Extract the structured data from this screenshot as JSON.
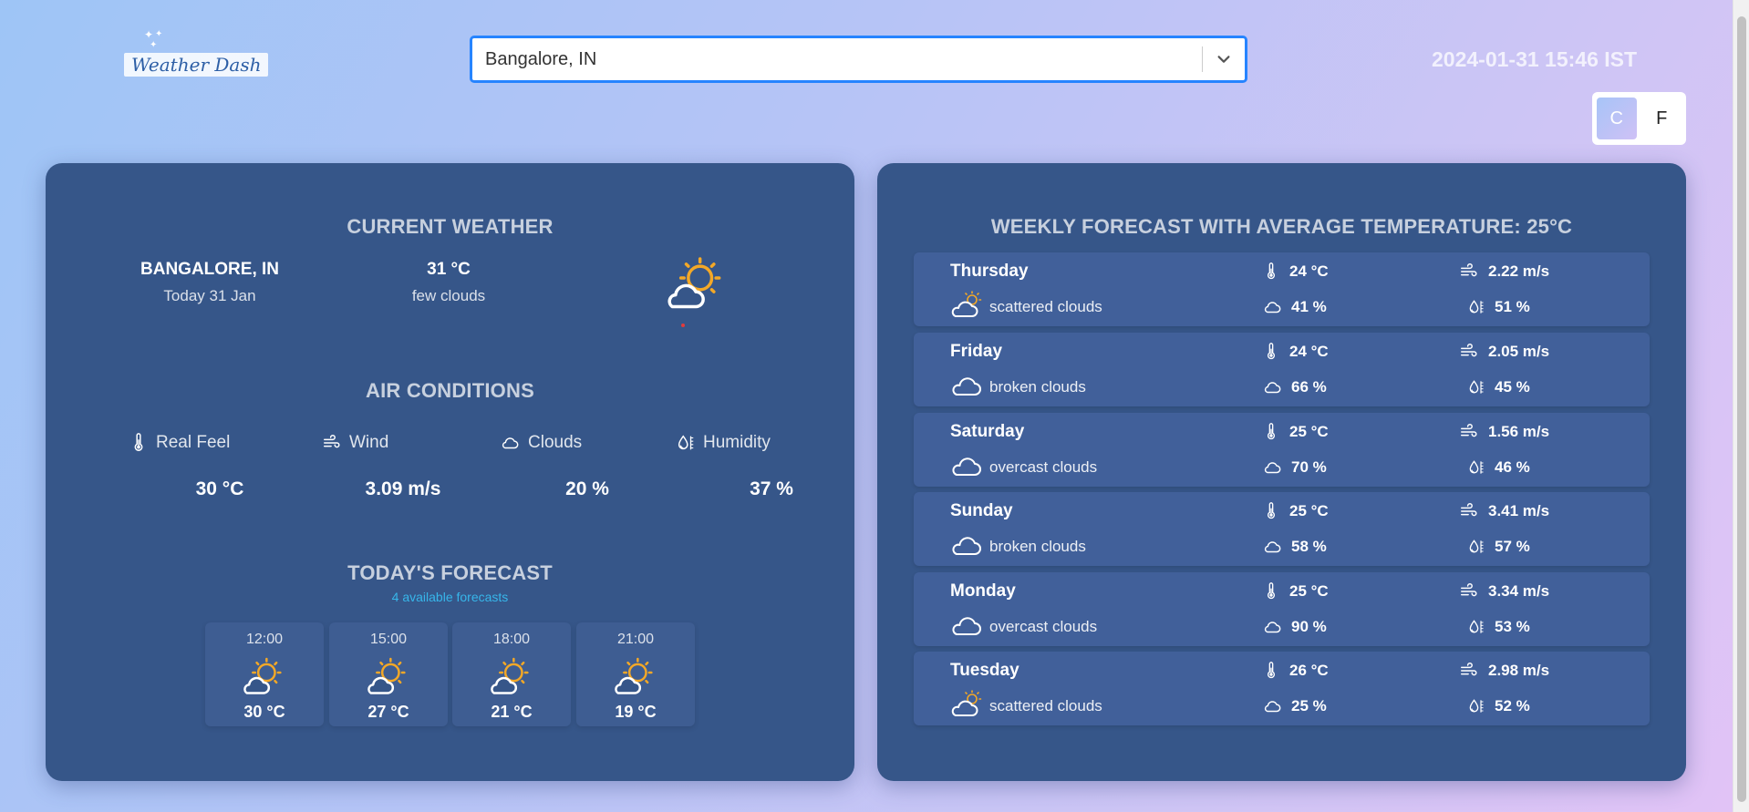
{
  "brand": {
    "logo_text": "Weather Dash"
  },
  "search": {
    "value": "Bangalore, IN"
  },
  "header": {
    "datetime": "2024-01-31 15:46 IST"
  },
  "units": {
    "celsius": "C",
    "fahrenheit": "F",
    "active": "C"
  },
  "current": {
    "title": "CURRENT WEATHER",
    "city": "BANGALORE, IN",
    "date": "Today 31 Jan",
    "temp": "31 °C",
    "description": "few clouds",
    "icon": "sun-behind-cloud-icon"
  },
  "air": {
    "title": "AIR CONDITIONS",
    "items": [
      {
        "label": "Real Feel",
        "value": "30 °C",
        "icon": "thermometer-icon"
      },
      {
        "label": "Wind",
        "value": "3.09 m/s",
        "icon": "wind-icon"
      },
      {
        "label": "Clouds",
        "value": "20 %",
        "icon": "cloud-icon"
      },
      {
        "label": "Humidity",
        "value": "37 %",
        "icon": "humidity-icon"
      }
    ]
  },
  "today": {
    "title": "TODAY'S FORECAST",
    "subtitle": "4 available forecasts",
    "items": [
      {
        "time": "12:00",
        "temp": "30 °C"
      },
      {
        "time": "15:00",
        "temp": "27 °C"
      },
      {
        "time": "18:00",
        "temp": "21 °C"
      },
      {
        "time": "21:00",
        "temp": "19 °C"
      }
    ]
  },
  "weekly": {
    "title": "WEEKLY FORECAST WITH AVERAGE TEMPERATURE: 25°C",
    "days": [
      {
        "day": "Thursday",
        "description": "scattered clouds",
        "icon": "sun-cloud-icon",
        "temp": "24 °C",
        "clouds": "41 %",
        "wind": "2.22 m/s",
        "humidity": "51 %"
      },
      {
        "day": "Friday",
        "description": "broken clouds",
        "icon": "cloud-icon",
        "temp": "24 °C",
        "clouds": "66 %",
        "wind": "2.05 m/s",
        "humidity": "45 %"
      },
      {
        "day": "Saturday",
        "description": "overcast clouds",
        "icon": "cloud-icon",
        "temp": "25 °C",
        "clouds": "70 %",
        "wind": "1.56 m/s",
        "humidity": "46 %"
      },
      {
        "day": "Sunday",
        "description": "broken clouds",
        "icon": "cloud-icon",
        "temp": "25 °C",
        "clouds": "58 %",
        "wind": "3.41 m/s",
        "humidity": "57 %"
      },
      {
        "day": "Monday",
        "description": "overcast clouds",
        "icon": "cloud-icon",
        "temp": "25 °C",
        "clouds": "90 %",
        "wind": "3.34 m/s",
        "humidity": "53 %"
      },
      {
        "day": "Tuesday",
        "description": "scattered clouds",
        "icon": "sun-cloud-icon",
        "temp": "26 °C",
        "clouds": "25 %",
        "wind": "2.98 m/s",
        "humidity": "52 %"
      }
    ]
  },
  "colors": {
    "panel": "#365689",
    "row": "#41609a",
    "accent": "#37b6ea",
    "sun": "#f3a827",
    "focus": "#2684ff"
  }
}
